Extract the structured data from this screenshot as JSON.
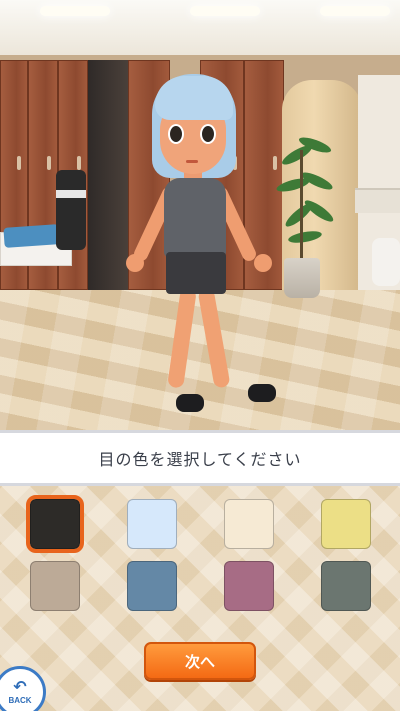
{
  "prompt": {
    "text": "目の色を選択してください"
  },
  "eye_color_swatches": [
    {
      "color": "#2d2b28",
      "selected": true
    },
    {
      "color": "#d6e8fb",
      "selected": false
    },
    {
      "color": "#f6ead4",
      "selected": false
    },
    {
      "color": "#ecdf86",
      "selected": false
    },
    {
      "color": "#bcaa97",
      "selected": false
    },
    {
      "color": "#6488a6",
      "selected": false
    },
    {
      "color": "#a76c85",
      "selected": false
    },
    {
      "color": "#6b7670",
      "selected": false
    }
  ],
  "next_button": {
    "label": "次へ"
  },
  "back_button": {
    "label": "BACK",
    "icon": "back-arrow-icon"
  },
  "colors": {
    "accent": "#f46a14",
    "selection_outline": "#e8641c",
    "back_blue": "#3c7bc6"
  }
}
